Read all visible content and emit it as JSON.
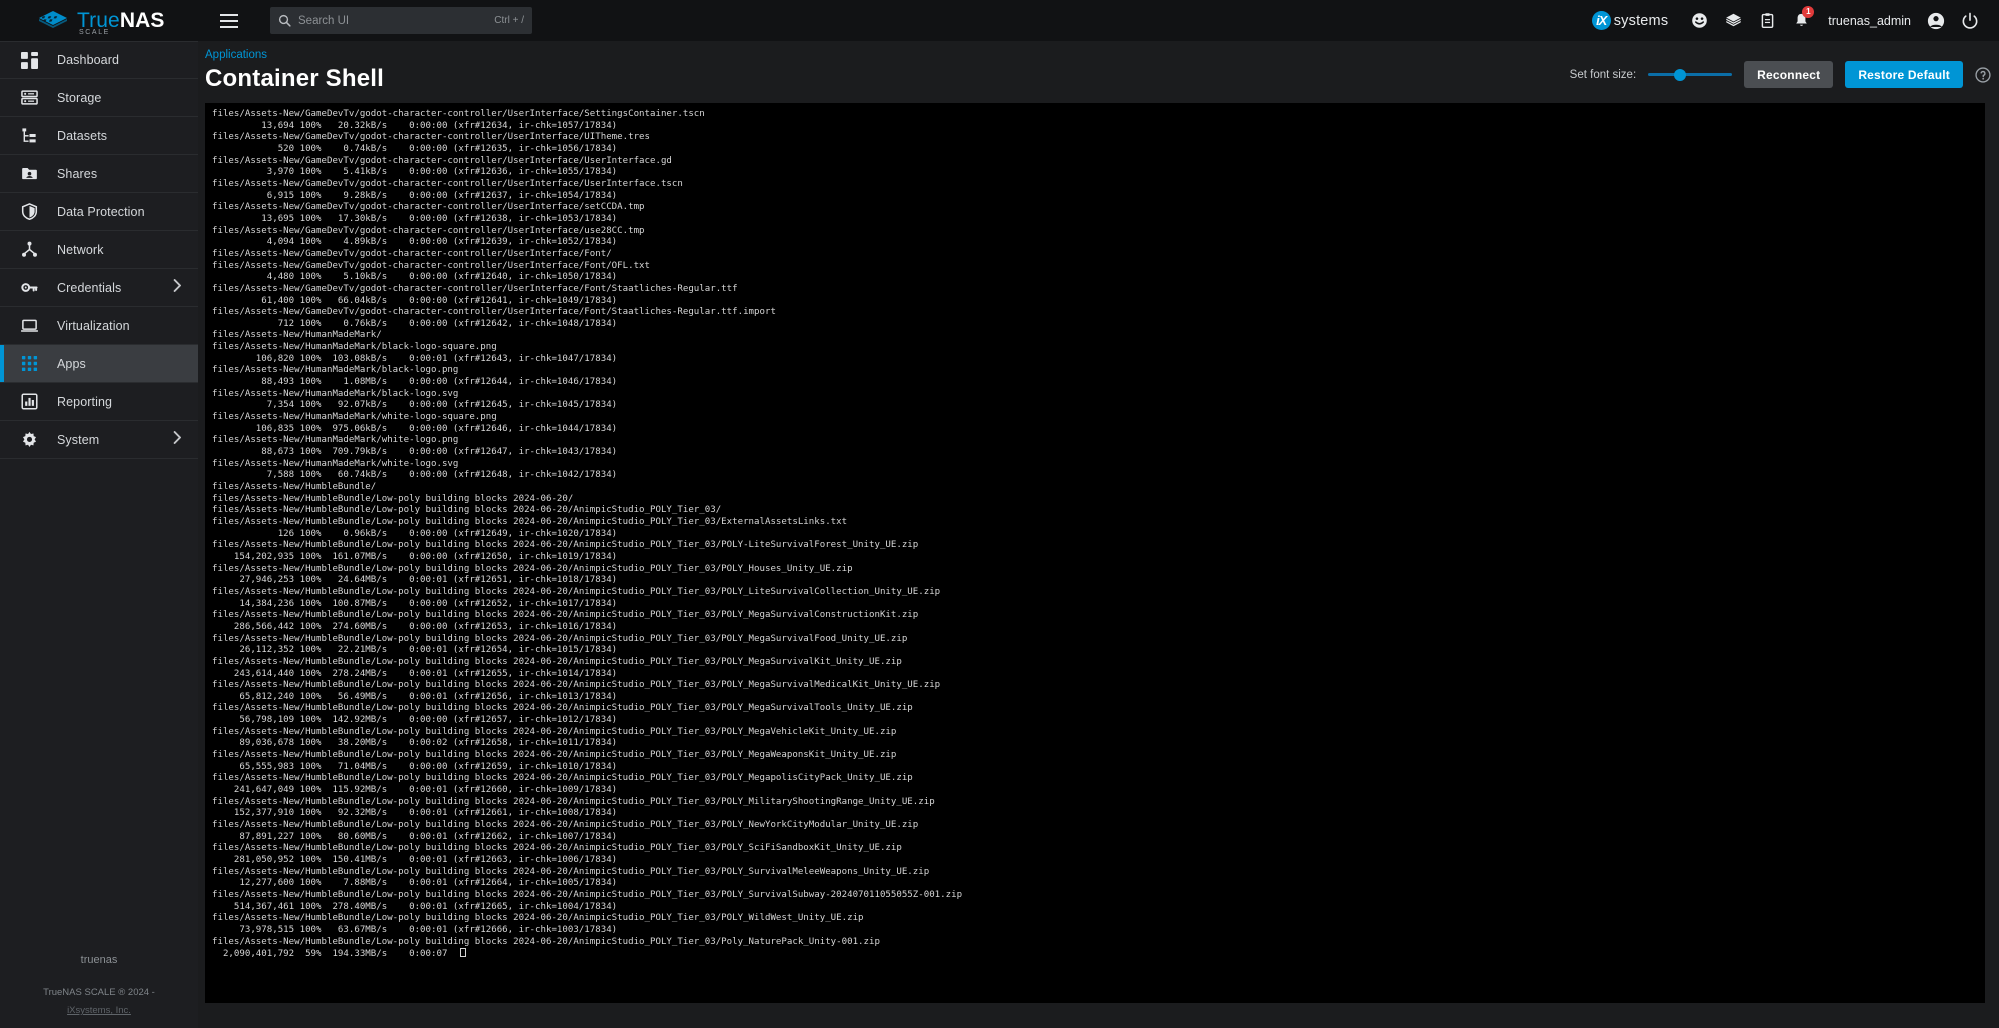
{
  "app": {
    "brand_true": "True",
    "brand_nas": "NAS",
    "brand_sub": "SCALE",
    "vendor": "systems",
    "vendor_mark": "iX"
  },
  "topbar": {
    "menu_icon": "hamburger-icon",
    "search_placeholder": "Search UI",
    "search_value": "",
    "search_shortcut": "Ctrl + /",
    "icons": [
      {
        "name": "smiley-face-icon",
        "label": ""
      },
      {
        "name": "truecommand-icon",
        "label": ""
      },
      {
        "name": "clipboard-tasks-icon",
        "label": ""
      },
      {
        "name": "notification-bell-icon",
        "label": "",
        "badge": "1"
      }
    ],
    "username": "truenas_admin",
    "account_icon": "account-circle-icon",
    "power_icon": "power-icon"
  },
  "sidebar": {
    "items": [
      {
        "label": "Dashboard",
        "icon": "dashboard-icon",
        "active": false,
        "expandable": false
      },
      {
        "label": "Storage",
        "icon": "storage-icon",
        "active": false,
        "expandable": false
      },
      {
        "label": "Datasets",
        "icon": "datasets-icon",
        "active": false,
        "expandable": false
      },
      {
        "label": "Shares",
        "icon": "shares-icon",
        "active": false,
        "expandable": false
      },
      {
        "label": "Data Protection",
        "icon": "shield-icon",
        "active": false,
        "expandable": false
      },
      {
        "label": "Network",
        "icon": "network-icon",
        "active": false,
        "expandable": false
      },
      {
        "label": "Credentials",
        "icon": "key-icon",
        "active": false,
        "expandable": true
      },
      {
        "label": "Virtualization",
        "icon": "monitor-icon",
        "active": false,
        "expandable": false
      },
      {
        "label": "Apps",
        "icon": "apps-grid-icon",
        "active": true,
        "expandable": false
      },
      {
        "label": "Reporting",
        "icon": "bar-chart-icon",
        "active": false,
        "expandable": false
      },
      {
        "label": "System",
        "icon": "gear-icon",
        "active": false,
        "expandable": true
      }
    ],
    "footer": {
      "hostname": "truenas",
      "copyright": "TrueNAS SCALE ® 2024 -",
      "link": "iXsystems, Inc."
    }
  },
  "page": {
    "breadcrumb": "Applications",
    "title": "Container Shell"
  },
  "toolbar": {
    "font_size_label": "Set font size:",
    "font_size_value": 38,
    "reconnect_label": "Reconnect",
    "restore_default_label": "Restore Default",
    "help_icon": "help-circle-icon"
  },
  "colors": {
    "accent": "#0095d5",
    "topbar_bg": "#111214",
    "sidebar_bg": "#1d1e21",
    "main_bg": "#1b1c1e",
    "terminal_bg": "#000000",
    "terminal_fg": "#d6d6d6",
    "badge_red": "#e13b3b",
    "btn_grey": "#4b4e52"
  },
  "terminal": {
    "cursor_visible": true,
    "lines": [
      "files/Assets-New/GameDevTv/godot-character-controller/UserInterface/SettingsContainer.tscn",
      "         13,694 100%   20.32kB/s    0:00:00 (xfr#12634, ir-chk=1057/17834)",
      "files/Assets-New/GameDevTv/godot-character-controller/UserInterface/UITheme.tres",
      "            520 100%    0.74kB/s    0:00:00 (xfr#12635, ir-chk=1056/17834)",
      "files/Assets-New/GameDevTv/godot-character-controller/UserInterface/UserInterface.gd",
      "          3,970 100%    5.41kB/s    0:00:00 (xfr#12636, ir-chk=1055/17834)",
      "files/Assets-New/GameDevTv/godot-character-controller/UserInterface/UserInterface.tscn",
      "          6,915 100%    9.28kB/s    0:00:00 (xfr#12637, ir-chk=1054/17834)",
      "files/Assets-New/GameDevTv/godot-character-controller/UserInterface/setCCDA.tmp",
      "         13,695 100%   17.30kB/s    0:00:00 (xfr#12638, ir-chk=1053/17834)",
      "files/Assets-New/GameDevTv/godot-character-controller/UserInterface/use28CC.tmp",
      "          4,094 100%    4.89kB/s    0:00:00 (xfr#12639, ir-chk=1052/17834)",
      "files/Assets-New/GameDevTv/godot-character-controller/UserInterface/Font/",
      "files/Assets-New/GameDevTv/godot-character-controller/UserInterface/Font/OFL.txt",
      "          4,480 100%    5.10kB/s    0:00:00 (xfr#12640, ir-chk=1050/17834)",
      "files/Assets-New/GameDevTv/godot-character-controller/UserInterface/Font/Staatliches-Regular.ttf",
      "         61,400 100%   66.04kB/s    0:00:00 (xfr#12641, ir-chk=1049/17834)",
      "files/Assets-New/GameDevTv/godot-character-controller/UserInterface/Font/Staatliches-Regular.ttf.import",
      "            712 100%    0.76kB/s    0:00:00 (xfr#12642, ir-chk=1048/17834)",
      "files/Assets-New/HumanMadeMark/",
      "files/Assets-New/HumanMadeMark/black-logo-square.png",
      "        106,820 100%  103.08kB/s    0:00:01 (xfr#12643, ir-chk=1047/17834)",
      "files/Assets-New/HumanMadeMark/black-logo.png",
      "         88,493 100%    1.08MB/s    0:00:00 (xfr#12644, ir-chk=1046/17834)",
      "files/Assets-New/HumanMadeMark/black-logo.svg",
      "          7,354 100%   92.07kB/s    0:00:00 (xfr#12645, ir-chk=1045/17834)",
      "files/Assets-New/HumanMadeMark/white-logo-square.png",
      "        106,835 100%  975.06kB/s    0:00:00 (xfr#12646, ir-chk=1044/17834)",
      "files/Assets-New/HumanMadeMark/white-logo.png",
      "         88,673 100%  709.79kB/s    0:00:00 (xfr#12647, ir-chk=1043/17834)",
      "files/Assets-New/HumanMadeMark/white-logo.svg",
      "          7,588 100%   60.74kB/s    0:00:00 (xfr#12648, ir-chk=1042/17834)",
      "files/Assets-New/HumbleBundle/",
      "files/Assets-New/HumbleBundle/Low-poly building blocks 2024-06-20/",
      "files/Assets-New/HumbleBundle/Low-poly building blocks 2024-06-20/AnimpicStudio_POLY_Tier_03/",
      "files/Assets-New/HumbleBundle/Low-poly building blocks 2024-06-20/AnimpicStudio_POLY_Tier_03/ExternalAssetsLinks.txt",
      "            126 100%    0.96kB/s    0:00:00 (xfr#12649, ir-chk=1020/17834)",
      "files/Assets-New/HumbleBundle/Low-poly building blocks 2024-06-20/AnimpicStudio_POLY_Tier_03/POLY-LiteSurvivalForest_Unity_UE.zip",
      "    154,202,935 100%  161.07MB/s    0:00:00 (xfr#12650, ir-chk=1019/17834)",
      "files/Assets-New/HumbleBundle/Low-poly building blocks 2024-06-20/AnimpicStudio_POLY_Tier_03/POLY_Houses_Unity_UE.zip",
      "     27,946,253 100%   24.64MB/s    0:00:01 (xfr#12651, ir-chk=1018/17834)",
      "files/Assets-New/HumbleBundle/Low-poly building blocks 2024-06-20/AnimpicStudio_POLY_Tier_03/POLY_LiteSurvivalCollection_Unity_UE.zip",
      "     14,384,236 100%  100.87MB/s    0:00:00 (xfr#12652, ir-chk=1017/17834)",
      "files/Assets-New/HumbleBundle/Low-poly building blocks 2024-06-20/AnimpicStudio_POLY_Tier_03/POLY_MegaSurvivalConstructionKit.zip",
      "    286,566,442 100%  274.60MB/s    0:00:00 (xfr#12653, ir-chk=1016/17834)",
      "files/Assets-New/HumbleBundle/Low-poly building blocks 2024-06-20/AnimpicStudio_POLY_Tier_03/POLY_MegaSurvivalFood_Unity_UE.zip",
      "     26,112,352 100%   22.21MB/s    0:00:01 (xfr#12654, ir-chk=1015/17834)",
      "files/Assets-New/HumbleBundle/Low-poly building blocks 2024-06-20/AnimpicStudio_POLY_Tier_03/POLY_MegaSurvivalKit_Unity_UE.zip",
      "    243,614,440 100%  278.24MB/s    0:00:01 (xfr#12655, ir-chk=1014/17834)",
      "files/Assets-New/HumbleBundle/Low-poly building blocks 2024-06-20/AnimpicStudio_POLY_Tier_03/POLY_MegaSurvivalMedicalKit_Unity_UE.zip",
      "     65,812,240 100%   56.49MB/s    0:00:01 (xfr#12656, ir-chk=1013/17834)",
      "files/Assets-New/HumbleBundle/Low-poly building blocks 2024-06-20/AnimpicStudio_POLY_Tier_03/POLY_MegaSurvivalTools_Unity_UE.zip",
      "     56,798,109 100%  142.92MB/s    0:00:00 (xfr#12657, ir-chk=1012/17834)",
      "files/Assets-New/HumbleBundle/Low-poly building blocks 2024-06-20/AnimpicStudio_POLY_Tier_03/POLY_MegaVehicleKit_Unity_UE.zip",
      "     89,036,678 100%   38.20MB/s    0:00:02 (xfr#12658, ir-chk=1011/17834)",
      "files/Assets-New/HumbleBundle/Low-poly building blocks 2024-06-20/AnimpicStudio_POLY_Tier_03/POLY_MegaWeaponsKit_Unity_UE.zip",
      "     65,555,983 100%   71.04MB/s    0:00:00 (xfr#12659, ir-chk=1010/17834)",
      "files/Assets-New/HumbleBundle/Low-poly building blocks 2024-06-20/AnimpicStudio_POLY_Tier_03/POLY_MegapolisCityPack_Unity_UE.zip",
      "    241,647,049 100%  115.92MB/s    0:00:01 (xfr#12660, ir-chk=1009/17834)",
      "files/Assets-New/HumbleBundle/Low-poly building blocks 2024-06-20/AnimpicStudio_POLY_Tier_03/POLY_MilitaryShootingRange_Unity_UE.zip",
      "    152,377,910 100%   92.32MB/s    0:00:01 (xfr#12661, ir-chk=1008/17834)",
      "files/Assets-New/HumbleBundle/Low-poly building blocks 2024-06-20/AnimpicStudio_POLY_Tier_03/POLY_NewYorkCityModular_Unity_UE.zip",
      "     87,891,227 100%   80.60MB/s    0:00:01 (xfr#12662, ir-chk=1007/17834)",
      "files/Assets-New/HumbleBundle/Low-poly building blocks 2024-06-20/AnimpicStudio_POLY_Tier_03/POLY_SciFiSandboxKit_Unity_UE.zip",
      "    281,050,952 100%  150.41MB/s    0:00:01 (xfr#12663, ir-chk=1006/17834)",
      "files/Assets-New/HumbleBundle/Low-poly building blocks 2024-06-20/AnimpicStudio_POLY_Tier_03/POLY_SurvivalMeleeWeapons_Unity_UE.zip",
      "     12,277,600 100%    7.88MB/s    0:00:01 (xfr#12664, ir-chk=1005/17834)",
      "files/Assets-New/HumbleBundle/Low-poly building blocks 2024-06-20/AnimpicStudio_POLY_Tier_03/POLY_SurvivalSubway-202407011055055Z-001.zip",
      "    514,367,461 100%  278.40MB/s    0:00:01 (xfr#12665, ir-chk=1004/17834)",
      "files/Assets-New/HumbleBundle/Low-poly building blocks 2024-06-20/AnimpicStudio_POLY_Tier_03/POLY_WildWest_Unity_UE.zip",
      "     73,978,515 100%   63.67MB/s    0:00:01 (xfr#12666, ir-chk=1003/17834)",
      "files/Assets-New/HumbleBundle/Low-poly building blocks 2024-06-20/AnimpicStudio_POLY_Tier_03/Poly_NaturePack_Unity-001.zip",
      "  2,090,401,792  59%  194.33MB/s    0:00:07  "
    ]
  }
}
